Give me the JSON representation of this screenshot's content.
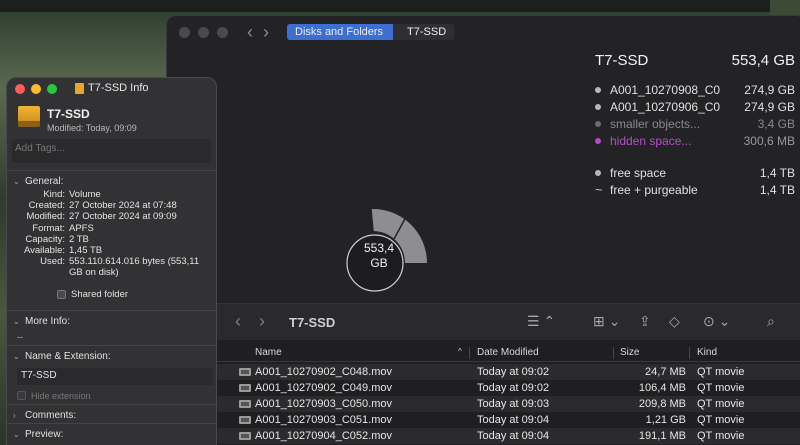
{
  "disk_window": {
    "breadcrumb": [
      "Disks and Folders",
      "T7-SSD"
    ],
    "summary": {
      "name": "T7-SSD",
      "total": "553,4 GB",
      "items": [
        {
          "label": "A001_10270908_C0",
          "value": "274,9 GB",
          "style": "normal"
        },
        {
          "label": "A001_10270906_C0",
          "value": "274,9 GB",
          "style": "normal"
        },
        {
          "label": "smaller objects...",
          "value": "3,4 GB",
          "style": "muted"
        },
        {
          "label": "hidden space...",
          "value": "300,6 MB",
          "style": "hidden"
        }
      ],
      "free_space_label": "free space",
      "free_space_value": "1,4 TB",
      "free_purgeable_label": "free + purgeable",
      "free_purgeable_value": "1,4 TB"
    },
    "donut_center": {
      "line1": "553,4",
      "line2": "GB"
    },
    "colors": {
      "accent": "#3c6fd1",
      "hidden": "#b04fc9",
      "segment": "#8e8e91"
    }
  },
  "finder": {
    "title": "T7-SSD",
    "columns": {
      "name": "Name",
      "date": "Date Modified",
      "size": "Size",
      "kind": "Kind"
    },
    "rows": [
      {
        "name": "A001_10270902_C048.mov",
        "date": "Today at 09:02",
        "size": "24,7 MB",
        "kind": "QT movie"
      },
      {
        "name": "A001_10270902_C049.mov",
        "date": "Today at 09:02",
        "size": "106,4 MB",
        "kind": "QT movie"
      },
      {
        "name": "A001_10270903_C050.mov",
        "date": "Today at 09:03",
        "size": "209,8 MB",
        "kind": "QT movie"
      },
      {
        "name": "A001_10270903_C051.mov",
        "date": "Today at 09:04",
        "size": "1,21 GB",
        "kind": "QT movie"
      },
      {
        "name": "A001_10270904_C052.mov",
        "date": "Today at 09:04",
        "size": "191,1 MB",
        "kind": "QT movie"
      }
    ]
  },
  "info_window": {
    "title": "T7-SSD Info",
    "name": "T7-SSD",
    "modified": "Modified: Today, 09:09",
    "tags_placeholder": "Add Tags...",
    "general_label": "General:",
    "general": [
      {
        "key": "Kind:",
        "value": "Volume"
      },
      {
        "key": "Created:",
        "value": "27 October 2024 at 07:48"
      },
      {
        "key": "Modified:",
        "value": "27 October 2024 at 09:09"
      },
      {
        "key": "Format:",
        "value": "APFS"
      },
      {
        "key": "Capacity:",
        "value": "2 TB"
      },
      {
        "key": "Available:",
        "value": "1,45 TB"
      },
      {
        "key": "Used:",
        "value": "553.110.614.016 bytes (553,11 GB on disk)"
      }
    ],
    "shared_folder": "Shared folder",
    "more_info_label": "More Info:",
    "more_info_value": "--",
    "name_ext_label": "Name & Extension:",
    "name_field": "T7-SSD",
    "hide_extension": "Hide extension",
    "comments_label": "Comments:",
    "preview_label": "Preview:"
  }
}
